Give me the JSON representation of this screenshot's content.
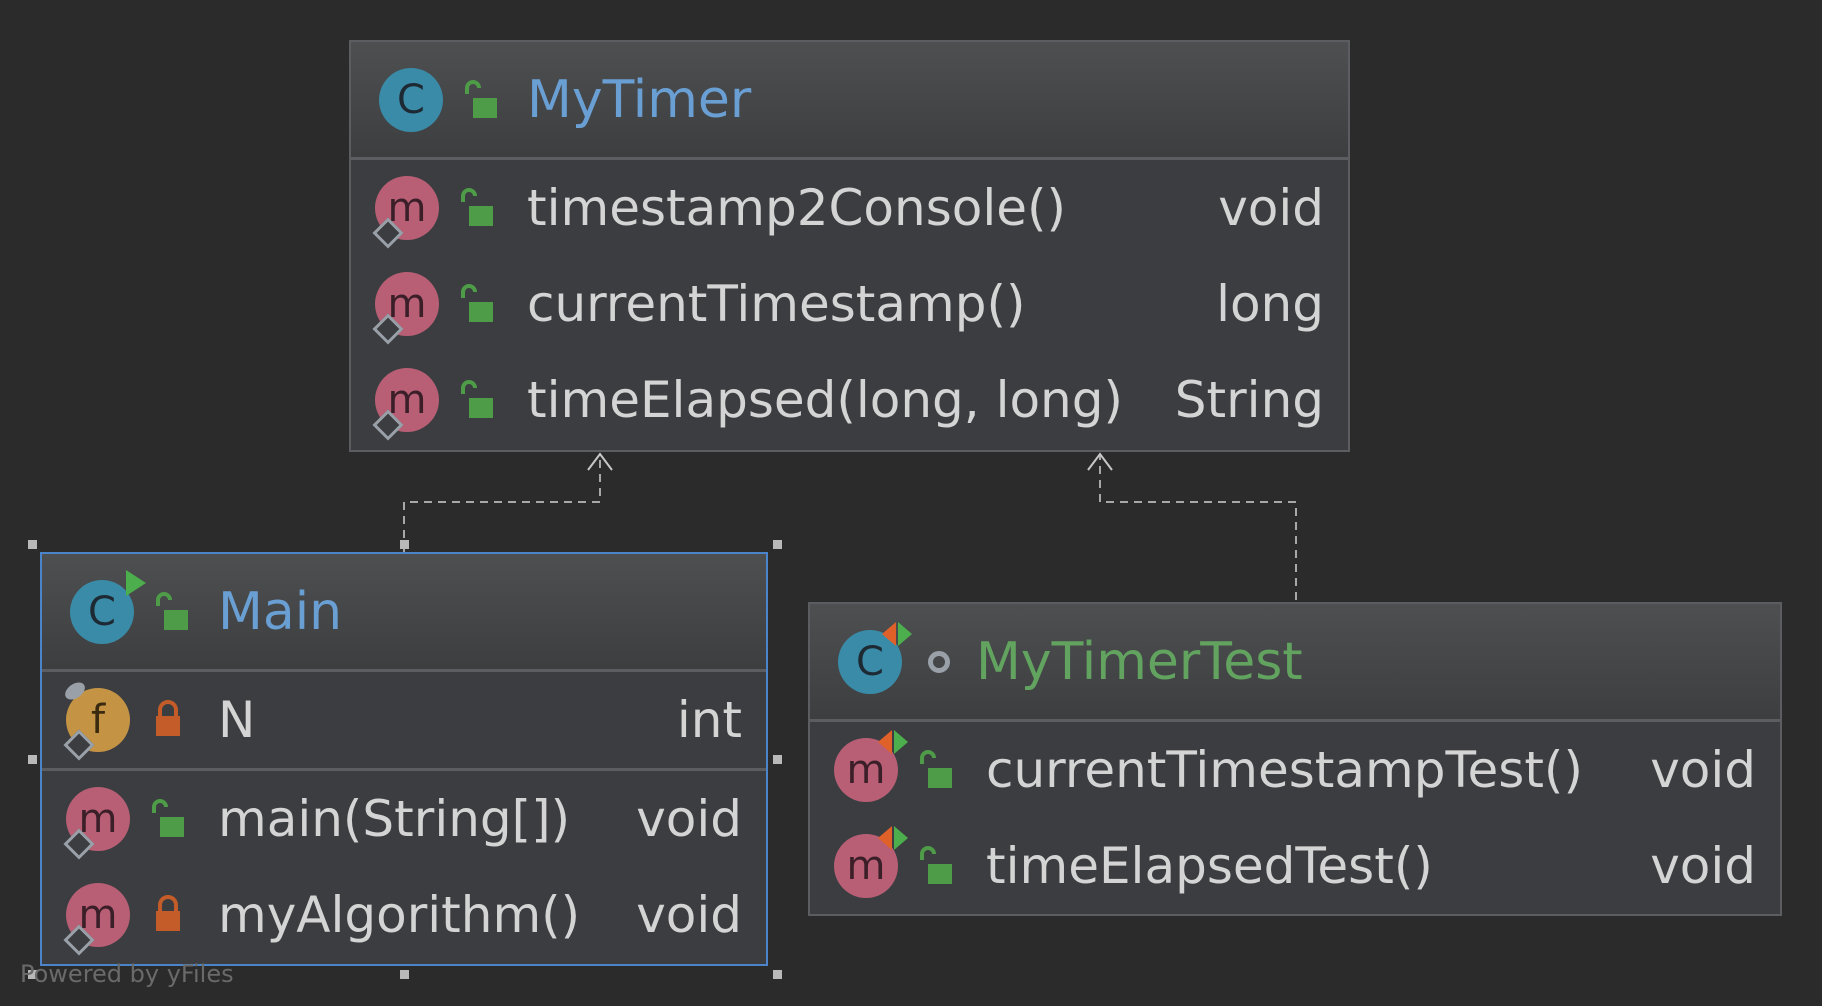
{
  "diagram": {
    "classes": [
      {
        "name": "MyTimer",
        "kind": "class",
        "visibility": "public",
        "groups": [
          [
            {
              "kind": "method",
              "visibility": "public",
              "name": "timestamp2Console()",
              "type": "void"
            },
            {
              "kind": "method",
              "visibility": "public",
              "name": "currentTimestamp()",
              "type": "long"
            },
            {
              "kind": "method",
              "visibility": "public",
              "name": "timeElapsed(long, long)",
              "type": "String"
            }
          ]
        ]
      },
      {
        "name": "Main",
        "kind": "runnable-class",
        "visibility": "public",
        "selected": true,
        "groups": [
          [
            {
              "kind": "field",
              "visibility": "private",
              "name": "N",
              "type": "int"
            }
          ],
          [
            {
              "kind": "method",
              "visibility": "public",
              "name": "main(String[])",
              "type": "void"
            },
            {
              "kind": "method",
              "visibility": "private",
              "name": "myAlgorithm()",
              "type": "void"
            }
          ]
        ]
      },
      {
        "name": "MyTimerTest",
        "kind": "test-class",
        "visibility": "package-private",
        "groups": [
          [
            {
              "kind": "test-method",
              "visibility": "public",
              "name": "currentTimestampTest()",
              "type": "void"
            },
            {
              "kind": "test-method",
              "visibility": "public",
              "name": "timeElapsedTest()",
              "type": "void"
            }
          ]
        ]
      }
    ],
    "relations": [
      {
        "from": "Main",
        "to": "MyTimer",
        "style": "dashed",
        "arrow": "open"
      },
      {
        "from": "MyTimerTest",
        "to": "MyTimer",
        "style": "dashed",
        "arrow": "open"
      }
    ]
  },
  "icons": {
    "class": "class-icon",
    "method": "method-icon",
    "field": "field-icon",
    "public": "unlocked-padlock-icon",
    "private": "locked-padlock-icon",
    "package-private": "package-dot-icon"
  },
  "colors": {
    "background": "#2b2b2b",
    "node": "#3b3d40",
    "class_title": "#6a9fd4",
    "test_title": "#62a35f",
    "public_lock": "#4f9c48",
    "private_lock": "#c45c2a",
    "selection": "#4b84c8"
  },
  "footer": {
    "credit": "Powered by yFiles"
  }
}
